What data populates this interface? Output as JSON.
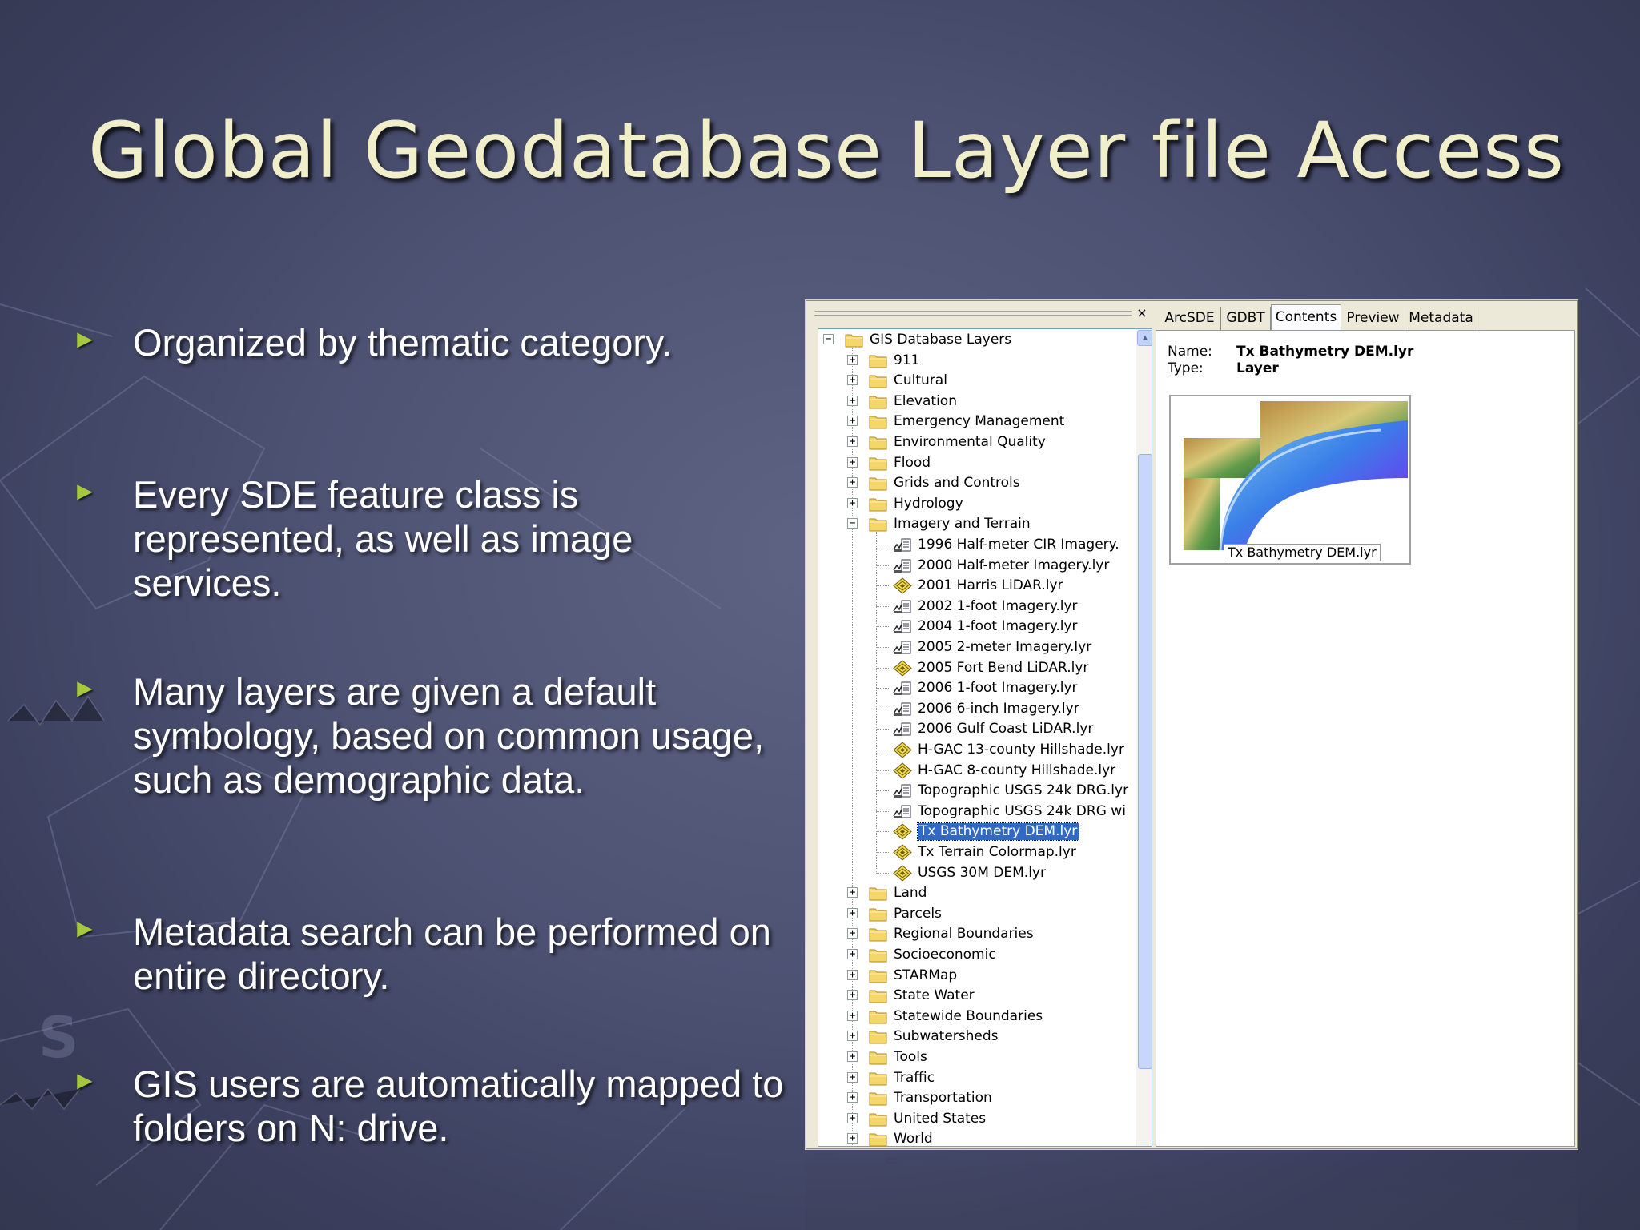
{
  "slide": {
    "title": "Global Geodatabase Layer file Access"
  },
  "bullets": [
    {
      "text": "Organized by thematic category."
    },
    {
      "text": "Every SDE feature class is represented, as well as image services."
    },
    {
      "text": "Many layers are given a default symbology, based on common usage, such as demographic data."
    },
    {
      "text": "Metadata search can be performed on entire directory."
    },
    {
      "text": "GIS users are automatically mapped to folders on N: drive."
    }
  ],
  "bullet_marker": "►",
  "colors": {
    "title": "#f1efc9",
    "bullet_marker": "#a5c83c",
    "selection": "#316ac5",
    "window_chrome": "#ece9d8"
  },
  "tree": {
    "close_glyph": "×",
    "root": {
      "label": "GIS Database Layers",
      "icon": "folder-icon",
      "expanded": true
    },
    "folders_before": [
      {
        "label": "911",
        "icon": "folder-icon"
      },
      {
        "label": "Cultural",
        "icon": "folder-icon"
      },
      {
        "label": "Elevation",
        "icon": "folder-icon"
      },
      {
        "label": "Emergency Management",
        "icon": "folder-icon"
      },
      {
        "label": "Environmental Quality",
        "icon": "folder-icon"
      },
      {
        "label": "Flood",
        "icon": "folder-icon"
      },
      {
        "label": "Grids and Controls",
        "icon": "folder-icon"
      },
      {
        "label": "Hydrology",
        "icon": "folder-icon"
      }
    ],
    "expanded_folder": {
      "label": "Imagery and Terrain",
      "icon": "folder-icon"
    },
    "children": [
      {
        "label": "1996 Half-meter CIR Imagery.",
        "icon": "raster-layer-icon"
      },
      {
        "label": "2000 Half-meter Imagery.lyr",
        "icon": "raster-layer-icon"
      },
      {
        "label": "2001 Harris LiDAR.lyr",
        "icon": "diamond-layer-icon"
      },
      {
        "label": "2002 1-foot Imagery.lyr",
        "icon": "raster-layer-icon"
      },
      {
        "label": "2004 1-foot Imagery.lyr",
        "icon": "raster-layer-icon"
      },
      {
        "label": "2005 2-meter Imagery.lyr",
        "icon": "raster-layer-icon"
      },
      {
        "label": "2005 Fort Bend LiDAR.lyr",
        "icon": "diamond-layer-icon"
      },
      {
        "label": "2006 1-foot Imagery.lyr",
        "icon": "raster-layer-icon"
      },
      {
        "label": "2006 6-inch Imagery.lyr",
        "icon": "raster-layer-icon"
      },
      {
        "label": "2006 Gulf Coast LiDAR.lyr",
        "icon": "raster-layer-icon"
      },
      {
        "label": "H-GAC 13-county Hillshade.lyr",
        "icon": "diamond-layer-icon"
      },
      {
        "label": "H-GAC 8-county Hillshade.lyr",
        "icon": "diamond-layer-icon"
      },
      {
        "label": "Topographic USGS 24k DRG.lyr",
        "icon": "raster-layer-icon"
      },
      {
        "label": "Topographic USGS 24k DRG wi",
        "icon": "raster-layer-icon"
      },
      {
        "label": "Tx Bathymetry DEM.lyr",
        "icon": "diamond-layer-icon",
        "selected": true
      },
      {
        "label": "Tx Terrain Colormap.lyr",
        "icon": "diamond-layer-icon"
      },
      {
        "label": "USGS 30M DEM.lyr",
        "icon": "diamond-layer-icon"
      }
    ],
    "folders_after": [
      {
        "label": "Land",
        "icon": "folder-icon"
      },
      {
        "label": "Parcels",
        "icon": "folder-icon"
      },
      {
        "label": "Regional Boundaries",
        "icon": "folder-icon"
      },
      {
        "label": "Socioeconomic",
        "icon": "folder-icon"
      },
      {
        "label": "STARMap",
        "icon": "folder-icon"
      },
      {
        "label": "State Water",
        "icon": "folder-icon"
      },
      {
        "label": "Statewide Boundaries",
        "icon": "folder-icon"
      },
      {
        "label": "Subwatersheds",
        "icon": "folder-icon"
      },
      {
        "label": "Tools",
        "icon": "folder-icon"
      },
      {
        "label": "Traffic",
        "icon": "folder-icon"
      },
      {
        "label": "Transportation",
        "icon": "folder-icon"
      },
      {
        "label": "United States",
        "icon": "folder-icon"
      },
      {
        "label": "World",
        "icon": "folder-icon"
      }
    ]
  },
  "tabs": [
    {
      "label": "ArcSDE"
    },
    {
      "label": "GDBT"
    },
    {
      "label": "Contents",
      "active": true
    },
    {
      "label": "Preview"
    },
    {
      "label": "Metadata"
    }
  ],
  "contents": {
    "name_key": "Name:",
    "name_value": "Tx Bathymetry DEM.lyr",
    "type_key": "Type:",
    "type_value": "Layer",
    "thumbnail_caption": "Tx Bathymetry DEM.lyr"
  }
}
